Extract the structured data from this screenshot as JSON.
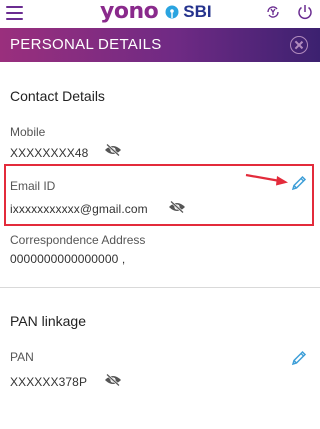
{
  "app": {
    "brand_yono": "yono",
    "brand_sbi": "SBI",
    "menu_icon": "hamburger-menu-icon",
    "right_icons": [
      "yono-cash-icon",
      "power-off-icon"
    ]
  },
  "header": {
    "title": "PERSONAL DETAILS",
    "close_icon": "close-circle-icon"
  },
  "contact": {
    "section_title": "Contact Details",
    "mobile_label": "Mobile",
    "mobile_value": "XXXXXXXX48",
    "email_label": "Email ID",
    "email_value": "ixxxxxxxxxxx@gmail.com",
    "address_label": "Correspondence Address",
    "address_value": "0000000000000000 ,"
  },
  "pan": {
    "section_title": "PAN linkage",
    "pan_label": "PAN",
    "pan_value": "XXXXXX378P"
  },
  "colors": {
    "brand_purple": "#8a2a8c",
    "header_gradient_start": "#9a2f7d",
    "header_gradient_end": "#3c2170",
    "highlight_red": "#e32b3b",
    "edit_blue": "#3f9fd8"
  }
}
